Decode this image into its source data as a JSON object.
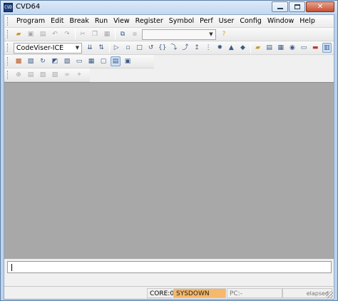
{
  "window": {
    "title": "CVD64",
    "app_icon_text": "CVD"
  },
  "menubar": {
    "items": [
      "Program",
      "Edit",
      "Break",
      "Run",
      "View",
      "Register",
      "Symbol",
      "Perf",
      "User",
      "Config",
      "Window",
      "Help"
    ]
  },
  "toolbar1": {
    "combo_value": "",
    "icons": [
      "open-folder-icon",
      "save-icon",
      "save-all-icon",
      "undo-icon",
      "redo-icon",
      "cut-icon",
      "copy-icon",
      "paste-icon",
      "find-icon",
      "find-next-icon",
      "help-icon"
    ]
  },
  "toolbar2": {
    "target_value": "CodeViser-ICE",
    "icons": [
      "download-icon",
      "load-icon",
      "go-icon",
      "step-icon",
      "stop-icon",
      "reset-icon",
      "step-over-icon",
      "step-into-icon",
      "step-out-icon",
      "run-to-icon",
      "breakpoint-icon",
      "trace-icon",
      "warning-icon",
      "diamond-icon",
      "source-view-icon",
      "disasm-view-icon",
      "register-view-icon",
      "memory-view-icon",
      "watch-view-icon",
      "stack-view-icon",
      "terminal-icon"
    ]
  },
  "toolbar3": {
    "icons": [
      "chip-icon",
      "flash-icon",
      "refresh-icon",
      "window-icon",
      "tile-icon",
      "cascade-icon",
      "grid-icon",
      "split-icon",
      "monitor-icon"
    ]
  },
  "toolbar4": {
    "icons": [
      "zoom-icon",
      "print-icon",
      "export-icon",
      "import-icon",
      "link-icon",
      "pin-icon"
    ]
  },
  "status": {
    "core": "CORE:0",
    "state": "SYSDOWN",
    "pc": "PC:-",
    "elapsed": "elapsed"
  },
  "colors": {
    "workspace": "#a8a8a8",
    "status_state_bg": "#f6b86a",
    "titlebar": "#c3d8f0"
  }
}
